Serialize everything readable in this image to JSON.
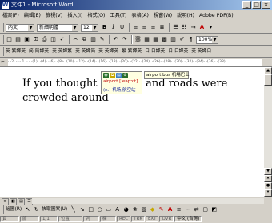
{
  "window": {
    "title": "文件1 - Microsoft Word",
    "min": "_",
    "max": "□",
    "close": "×"
  },
  "menu": [
    "檔案(F)",
    "編輯(E)",
    "檢視(V)",
    "插入(I)",
    "格式(O)",
    "工具(T)",
    "表格(A)",
    "視窗(W)",
    "說明(H)",
    "Adobe PDF(B)"
  ],
  "format_toolbar": {
    "style": "内文",
    "font": "新細明體",
    "size": "12",
    "zoom": "100%"
  },
  "standard_toolbar": {
    "zoom": "100%"
  },
  "dict_toolbar": [
    "英 繁譯英",
    "简 简譯英",
    "英 英譯繁",
    "英 英譯简",
    "英 英譯英",
    "繁 繁譯英",
    "日 日譯英",
    "日 日譯英",
    "英 英譯日"
  ],
  "ruler": {
    "marks": "· ·2· ·(·· 1 ·· · ·(1)· ·(4)· ·(6)· ·(8)· ·(10)· ·(12)· ·(14)· ·(16)· ·(18)· ·(20)· ·(22)· ·(24)· ·(26)· ·(28)· ·(30)· ·(32)· ·(34)· ·(36)· ·(38)"
  },
  "document": {
    "line1": "If you thought airports and roads were",
    "line2": "crowded around"
  },
  "tooltip": {
    "headword": "airport [ˈeəpɔːt]",
    "definition": "(n.) 机场,航空站",
    "extra": "airport bus 机場巴士"
  },
  "draw_toolbar": {
    "draw": "繪圖(R)",
    "autoshapes": "快取圖案(U)"
  },
  "status_bar": {
    "page": "頁",
    "section": "節",
    "pos": "1/1",
    "at": "位置",
    "line": "列",
    "col": "欄",
    "rec": "REC",
    "trk": "TRK",
    "ext": "EXT",
    "ovr": "OVR",
    "lang": "中文 (台灣)"
  },
  "colors": {
    "titlebar_start": "#0a246a",
    "titlebar_end": "#a6caf0",
    "tooltip_bg": "#ffffe1",
    "headword": "#c00000",
    "definition": "#1a2e9e"
  }
}
